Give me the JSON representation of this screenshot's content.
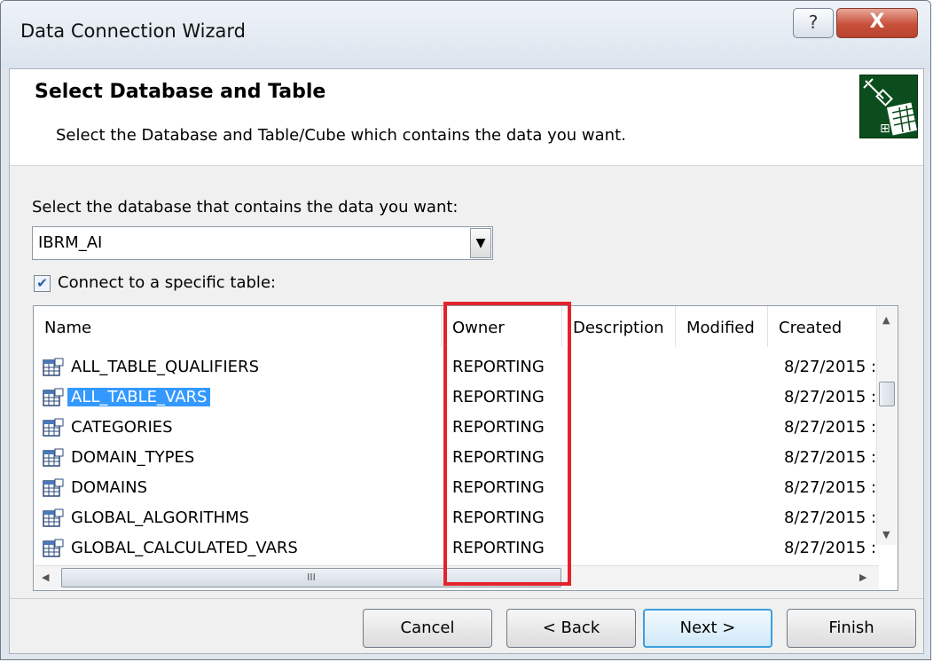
{
  "window": {
    "title": "Data Connection Wizard",
    "help_glyph": "?",
    "close_glyph": "X"
  },
  "header": {
    "title": "Select Database and Table",
    "subtitle": "Select the Database and Table/Cube which contains the data you want."
  },
  "database": {
    "label": "Select the database that contains the data you want:",
    "selected": "IBRM_AI"
  },
  "specific_table": {
    "label": "Connect to a specific table:",
    "checked": true
  },
  "columns": [
    "Name",
    "Owner",
    "Description",
    "Modified",
    "Created"
  ],
  "rows": [
    {
      "name": "ALL_TABLE_QUALIFIERS",
      "owner": "REPORTING",
      "description": "",
      "modified": "",
      "created": "8/27/2015 :"
    },
    {
      "name": "ALL_TABLE_VARS",
      "owner": "REPORTING",
      "description": "",
      "modified": "",
      "created": "8/27/2015 :",
      "selected": true
    },
    {
      "name": "CATEGORIES",
      "owner": "REPORTING",
      "description": "",
      "modified": "",
      "created": "8/27/2015 :"
    },
    {
      "name": "DOMAIN_TYPES",
      "owner": "REPORTING",
      "description": "",
      "modified": "",
      "created": "8/27/2015 :"
    },
    {
      "name": "DOMAINS",
      "owner": "REPORTING",
      "description": "",
      "modified": "",
      "created": "8/27/2015 :"
    },
    {
      "name": "GLOBAL_ALGORITHMS",
      "owner": "REPORTING",
      "description": "",
      "modified": "",
      "created": "8/27/2015 :"
    },
    {
      "name": "GLOBAL_CALCULATED_VARS",
      "owner": "REPORTING",
      "description": "",
      "modified": "",
      "created": "8/27/2015 :"
    }
  ],
  "scroll": {
    "hthumb_glyph": "III"
  },
  "buttons": {
    "cancel": "Cancel",
    "back": "< Back",
    "next": "Next >",
    "finish": "Finish"
  },
  "colors": {
    "highlight": "#e4232b",
    "selection": "#3399ff",
    "accent": "#3b9fdf"
  },
  "icons": {
    "table": "table-icon",
    "wizard": "data-connection-plug-icon"
  }
}
